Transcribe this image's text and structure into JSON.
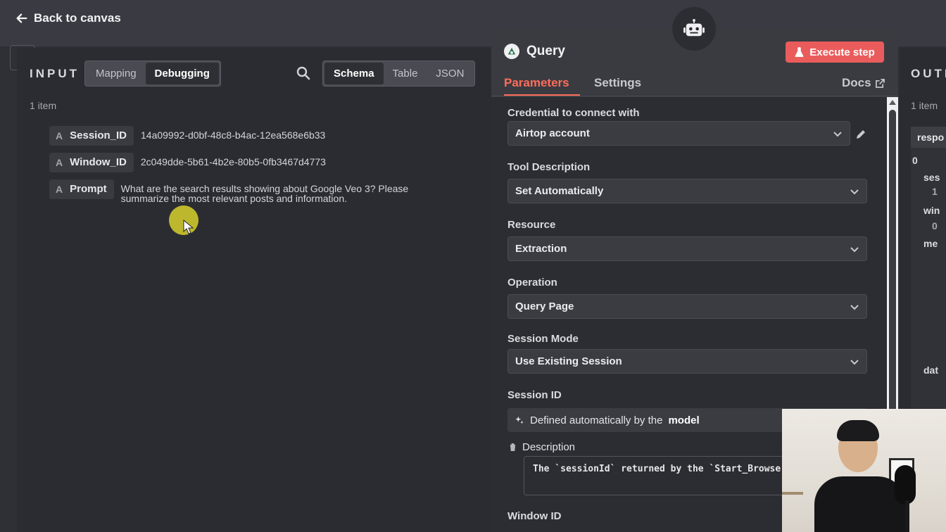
{
  "topbar": {
    "back_label": "Back to canvas"
  },
  "input_panel": {
    "title": "INPUT",
    "mode_options": [
      "Mapping",
      "Debugging"
    ],
    "mode_selected": "Debugging",
    "view_options": [
      "Schema",
      "Table",
      "JSON"
    ],
    "view_selected": "Schema",
    "item_count": "1 item",
    "fields": [
      {
        "type": "A",
        "name": "Session_ID",
        "value": "14a09992-d0bf-48c8-b4ac-12ea568e6b33"
      },
      {
        "type": "A",
        "name": "Window_ID",
        "value": "2c049dde-5b61-4b2e-80b5-0fb3467d4773"
      },
      {
        "type": "A",
        "name": "Prompt",
        "value": "What are the search results showing about Google Veo 3? Please summarize the most relevant posts and information."
      }
    ]
  },
  "node": {
    "title": "Query",
    "execute_label": "Execute step",
    "tabs": [
      "Parameters",
      "Settings"
    ],
    "active_tab": "Parameters",
    "docs_label": "Docs",
    "params": {
      "credential_label": "Credential to connect with",
      "credential_value": "Airtop account",
      "tool_description_label": "Tool Description",
      "tool_description_value": "Set Automatically",
      "resource_label": "Resource",
      "resource_value": "Extraction",
      "operation_label": "Operation",
      "operation_value": "Query Page",
      "session_mode_label": "Session Mode",
      "session_mode_value": "Use Existing Session",
      "session_id_label": "Session ID",
      "auto_text": "Defined automatically by the",
      "auto_bold": "model",
      "description_label": "Description",
      "description_code": "The `sessionId` returned by the `Start_Browser",
      "window_id_label": "Window ID"
    }
  },
  "output_panel": {
    "title": "OUTPUT",
    "item_count": "1 item",
    "header": "respo",
    "index": "0",
    "keys": [
      "ses",
      "win",
      "me",
      "dat"
    ],
    "values": [
      "1",
      "0"
    ]
  },
  "colors": {
    "accent": "#ff6d5a",
    "execute": "#ea5c5c",
    "panel": "#2b2c31"
  }
}
